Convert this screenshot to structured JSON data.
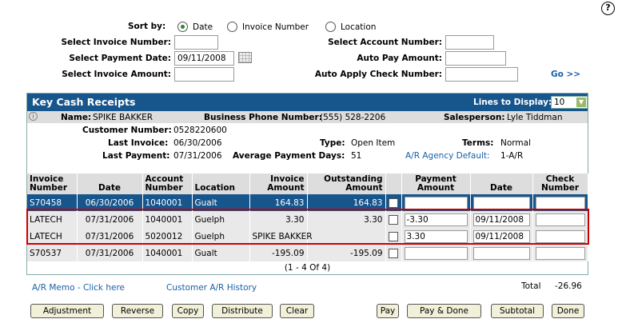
{
  "filters": {
    "sort_by_label": "Sort by:",
    "sort_options": [
      "Date",
      "Invoice Number",
      "Location"
    ],
    "invoice_number_label": "Select Invoice Number:",
    "invoice_number_value": "",
    "payment_date_label": "Select Payment Date:",
    "payment_date_value": "09/11/2008",
    "invoice_amount_label": "Select Invoice Amount:",
    "invoice_amount_value": "",
    "account_number_label": "Select Account Number:",
    "account_number_value": "",
    "auto_pay_label": "Auto Pay Amount:",
    "auto_pay_value": "",
    "auto_apply_label": "Auto Apply Check Number:",
    "auto_apply_value": "",
    "go_label": "Go >>"
  },
  "panel": {
    "title": "Key Cash Receipts",
    "lines_label": "Lines to Display:",
    "lines_value": "10"
  },
  "customer": {
    "name_label": "Name:",
    "name": "SPIKE BAKKER",
    "phone_label": "Business Phone Number:",
    "phone": "(555) 528-2206",
    "salesperson_label": "Salesperson:",
    "salesperson": "Lyle Tiddman",
    "number_label": "Customer Number:",
    "number": "0528220600",
    "last_invoice_label": "Last Invoice:",
    "last_invoice": "06/30/2006",
    "type_label": "Type:",
    "type": "Open Item",
    "terms_label": "Terms:",
    "terms": "Normal",
    "last_payment_label": "Last Payment:",
    "last_payment": "07/31/2006",
    "avg_days_label": "Average Payment Days:",
    "avg_days": "51",
    "agency_label": "A/R Agency Default:",
    "agency": "1-A/R"
  },
  "grid": {
    "headers": [
      "Invoice Number",
      "Date",
      "Account Number",
      "Location",
      "Invoice Amount",
      "Outstanding Amount",
      "",
      "Payment Amount",
      "Date",
      "Check Number"
    ],
    "rows": [
      {
        "invoice": "S70458",
        "date": "06/30/2006",
        "account": "1040001",
        "location": "Gualt",
        "amount": "164.83",
        "outstanding": "164.83",
        "payment": "",
        "pay_date": "",
        "check": ""
      },
      {
        "invoice": "LATECH",
        "date": "07/31/2006",
        "account": "1040001",
        "location": "Guelph",
        "amount": "3.30",
        "outstanding": "3.30",
        "payment": "-3.30",
        "pay_date": "09/11/2008",
        "check": ""
      },
      {
        "invoice": "LATECH",
        "date": "07/31/2006",
        "account": "5020012",
        "location": "Guelph",
        "amount": "SPIKE BAKKER",
        "outstanding": "",
        "payment": "3.30",
        "pay_date": "09/11/2008",
        "check": ""
      },
      {
        "invoice": "S70537",
        "date": "07/31/2006",
        "account": "1040001",
        "location": "Gualt",
        "amount": "-195.09",
        "outstanding": "-195.09",
        "payment": "",
        "pay_date": "",
        "check": ""
      }
    ],
    "pager": "(1 - 4 Of 4)"
  },
  "footer": {
    "memo_link": "A/R Memo - Click here",
    "history_link": "Customer A/R History",
    "total_label": "Total",
    "total_value": "-26.96"
  },
  "buttons": {
    "adjustment": "Adjustment",
    "reverse": "Reverse",
    "copy": "Copy",
    "distribute": "Distribute",
    "clear": "Clear",
    "pay": "Pay",
    "pay_done": "Pay & Done",
    "subtotal": "Subtotal",
    "done": "Done"
  },
  "colors": {
    "panel_header": "#17558d",
    "link": "#1a5fa8",
    "highlight_box": "#cc0000",
    "button_bg": "#f1f0d9"
  }
}
